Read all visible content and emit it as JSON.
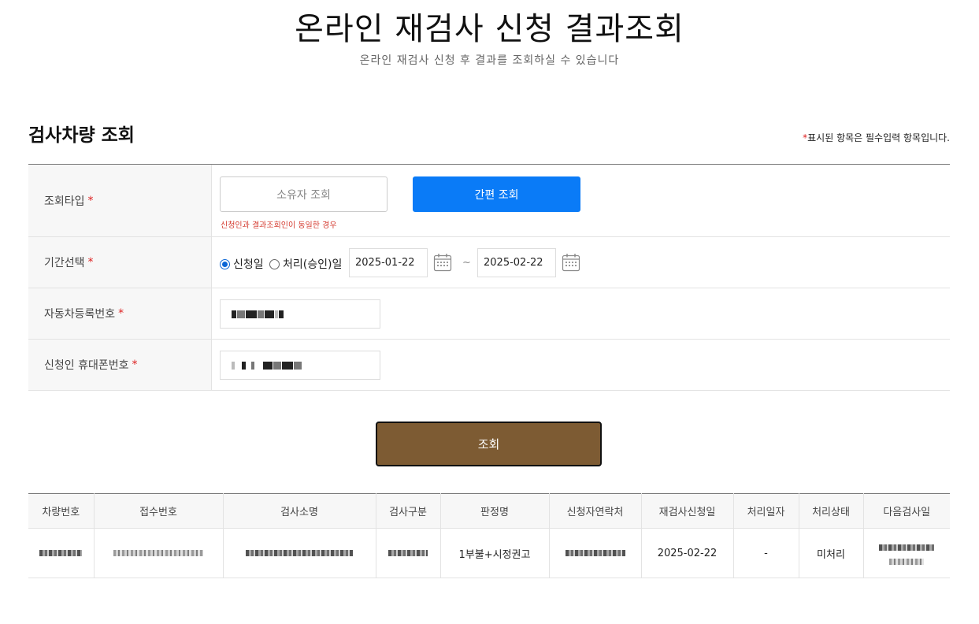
{
  "header": {
    "title": "온라인 재검사 신청 결과조회",
    "subtitle": "온라인 재검사 신청 후 결과를 조회하실 수 있습니다"
  },
  "section": {
    "title": "검사차량 조회",
    "required_star": "*",
    "required_note": "표시된 항목은 필수입력 항목입니다."
  },
  "form": {
    "rows": [
      {
        "label": "조회타입",
        "star": "*"
      },
      {
        "label": "기간선택",
        "star": "*"
      },
      {
        "label": "자동차등록번호",
        "star": "*"
      },
      {
        "label": "신청인 휴대폰번호",
        "star": "*"
      }
    ],
    "type": {
      "owner_label": "소유자 조회",
      "simple_label": "간편 조회",
      "selected": "간편 조회",
      "hint": "신청인과 결과조회인이 동일한 경우"
    },
    "period": {
      "radio_apply": "신청일",
      "radio_process": "처리(승인)일",
      "selected": "신청일",
      "start_date": "2025-01-22",
      "end_date": "2025-02-22",
      "separator": "~"
    }
  },
  "search_button": "조회",
  "results": {
    "columns": [
      "차량번호",
      "접수번호",
      "검사소명",
      "검사구분",
      "판정명",
      "신청자연락처",
      "재검사신청일",
      "처리일자",
      "처리상태",
      "다음검사일"
    ],
    "rows": [
      {
        "judgement": "1부불+시정권고",
        "request_date": "2025-02-22",
        "process_date": "-",
        "status": "미처리"
      }
    ]
  },
  "colors": {
    "primary_blue": "#0a7bf7",
    "search_brown": "#7d5b33",
    "required_red": "#d22222"
  }
}
